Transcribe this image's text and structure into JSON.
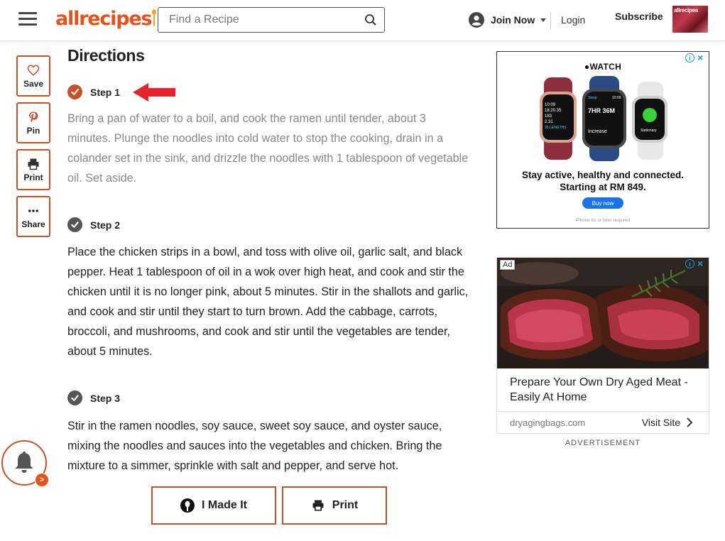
{
  "header": {
    "logo_text": "allrecipes",
    "search_placeholder": "Find a Recipe",
    "join_label": "Join Now",
    "login_label": "Login",
    "subscribe_label": "Subscribe",
    "magazine_title": "allrecipes"
  },
  "side_actions": [
    {
      "label": "Save",
      "icon": "heart-icon"
    },
    {
      "label": "Pin",
      "icon": "pinterest-icon"
    },
    {
      "label": "Print",
      "icon": "printer-icon"
    },
    {
      "label": "Share",
      "icon": "more-icon"
    }
  ],
  "directions": {
    "title": "Directions",
    "steps": [
      {
        "title": "Step 1",
        "checked": true,
        "text": "Bring a pan of water to a boil, and cook the ramen until tender, about 3 minutes. Plunge the noodles into cold water to stop the cooking, drain in a colander set in the sink, and drizzle the noodles with 1 tablespoon of vegetable oil. Set aside."
      },
      {
        "title": "Step 2",
        "checked": false,
        "text": "Place the chicken strips in a bowl, and toss with olive oil, garlic salt, and black pepper. Heat 1 tablespoon of oil in a wok over high heat, and cook and stir the chicken until it is no longer pink, about 5 minutes. Stir in the shallots and garlic, and cook and stir until they start to turn brown. Add the cabbage, carrots, broccoli, and mushrooms, and cook and stir until the vegetables are tender, about 5 minutes."
      },
      {
        "title": "Step 3",
        "checked": false,
        "text": "Stir in the ramen noodles, soy sauce, sweet soy sauce, and oyster sauce, mixing the noodles and sauces into the vegetables and chicken. Bring the mixture to a simmer, sprinkle with salt and pepper, and serve hot."
      }
    ]
  },
  "bottom_buttons": {
    "made_it_label": "I Made It",
    "print_label": "Print"
  },
  "notification": {
    "badge": ">"
  },
  "ads": {
    "watch_ad": {
      "brand": "WATCH",
      "headline": "Stay active, healthy and connected. Starting at RM 849.",
      "cta": "Buy now",
      "fine_print": "iPhone 6s or later required",
      "watch_screen_1": [
        "10:09",
        "18:20.35",
        "183",
        "2.31",
        "36 LENGTHS"
      ],
      "watch_screen_2": [
        "Sleep",
        "10:09",
        "7HR 36M",
        "Increase"
      ],
      "watch_screen_3": [
        "10:09",
        "Stationary"
      ]
    },
    "meat_ad": {
      "tag": "Ad",
      "headline": "Prepare Your Own Dry Aged Meat - Easily At Home",
      "domain": "dryagingbags.com",
      "cta": "Visit Site"
    },
    "advertisement_label": "ADVERTISEMENT"
  },
  "colors": {
    "brand": "#e2541b",
    "button_border": "#c8512b",
    "step_checked": "#c8512b",
    "step_unchecked": "#555555",
    "ad_blue": "#1a9bd7"
  }
}
